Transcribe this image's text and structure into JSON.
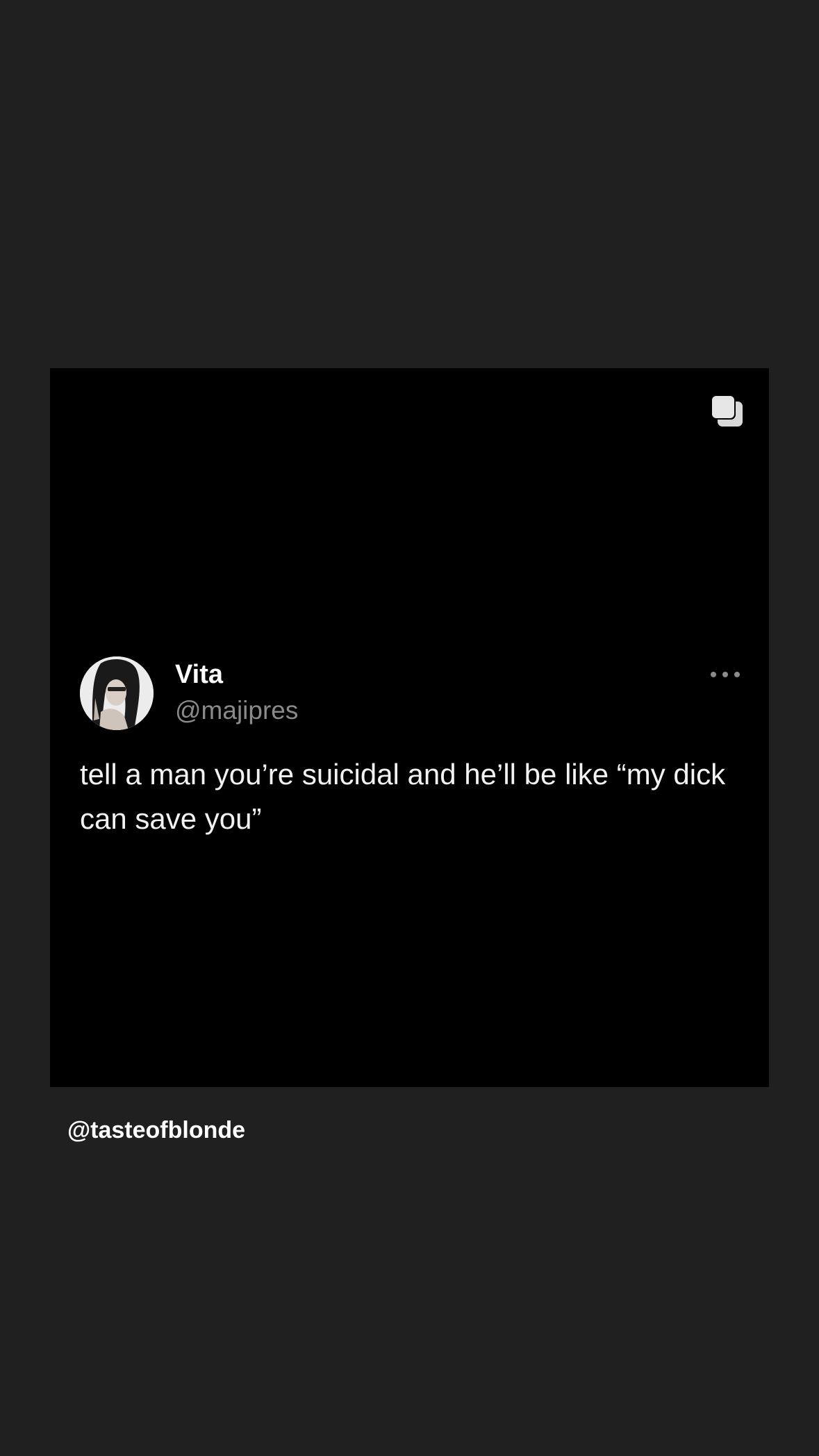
{
  "post": {
    "author": {
      "display_name": "Vita",
      "handle": "@majipres",
      "avatar_icon": "profile-photo"
    },
    "text": "tell a man you’re suicidal and he’ll be like “my dick can save you”",
    "more_icon": "ellipsis-icon",
    "carousel_icon": "multiple-images-icon"
  },
  "watermark": "@tasteofblonde",
  "colors": {
    "background": "#202020",
    "card": "#000000",
    "text_primary": "#ffffff",
    "text_secondary": "#8a8a8a"
  }
}
